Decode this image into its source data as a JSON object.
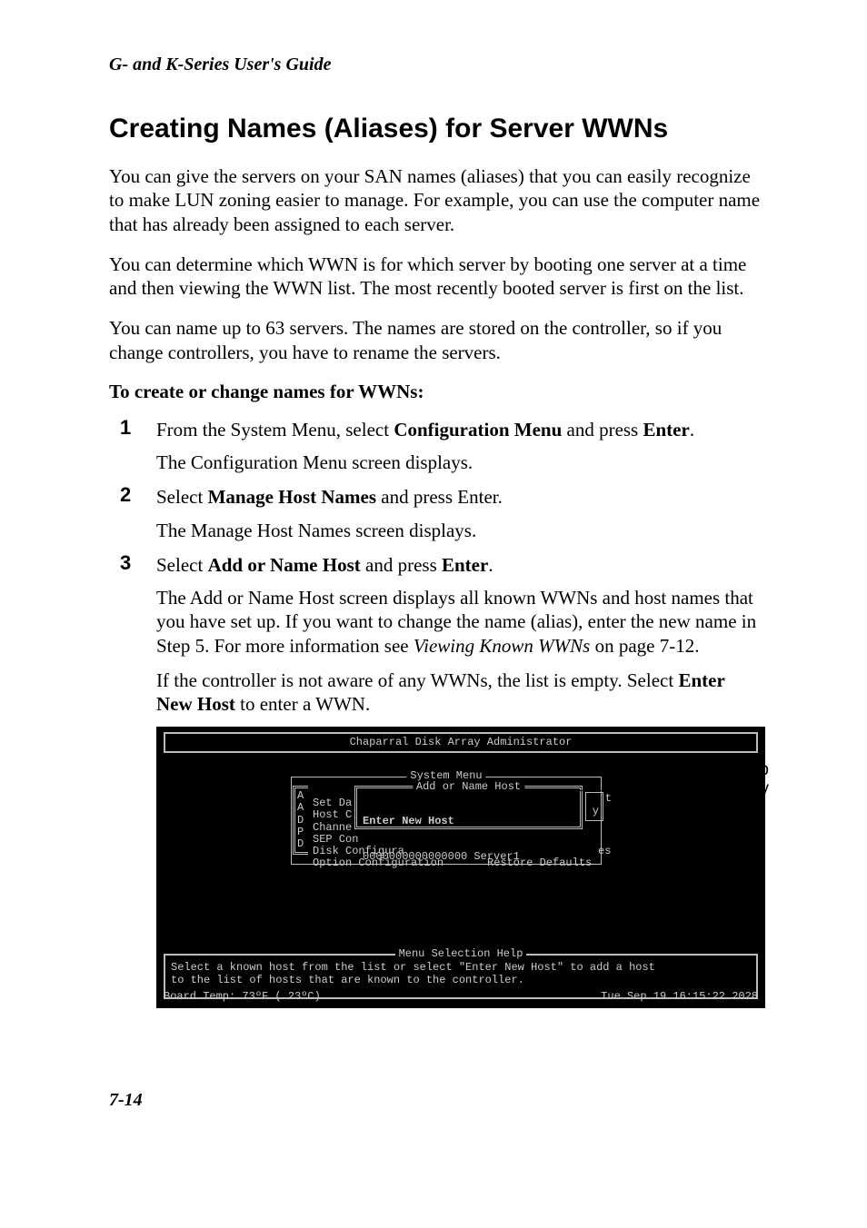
{
  "runningHead": "G- and K-Series User's Guide",
  "sectionTitle": "Creating Names (Aliases) for Server WWNs",
  "para1": "You can give the servers on your SAN names (aliases) that you can easily recognize to make LUN zoning easier to manage. For example, you can use the computer name that has already been assigned to each server.",
  "para2": "You can determine which WWN is for which server by booting one server at a time and then viewing the WWN list. The most recently booted server is first on the list.",
  "para3": "You can name up to 63 servers. The names are stored on the controller, so if you change controllers, you have to rename the servers.",
  "procHead": "To create or change names for WWNs:",
  "steps": [
    {
      "main_a": "From the System Menu, select ",
      "main_b": "Configuration Menu",
      "main_c": " and press ",
      "main_d": "Enter",
      "main_e": ".",
      "sub1": "The Configuration Menu screen displays."
    },
    {
      "main_a": "Select ",
      "main_b": "Manage Host Names",
      "main_c": " and press Enter.",
      "sub1": "The Manage Host Names screen displays."
    },
    {
      "main_a": "Select ",
      "main_b": "Add or Name Host",
      "main_c": " and press ",
      "main_d": "Enter",
      "main_e": ".",
      "sub1_a": "The Add or Name Host screen displays all known WWNs and host names that you have set up. If you want to change the name (alias), enter the new name in Step 5. For more information see ",
      "sub1_b": "Viewing Known WWNs",
      "sub1_c": " on page 7-12.",
      "sub2_a": "If the controller is not aware of any WWNs, the list is empty. Select ",
      "sub2_b": "Enter New Host",
      "sub2_c": " to enter a WWN."
    }
  ],
  "terminal": {
    "title": "Chaparral Disk Array Administrator",
    "sysMenuLabel": "System Menu",
    "addHostLabel": "Add or Name Host",
    "leftCol": "A\nA\nD\nP\nD",
    "midCol": "Set Da\nHost C\nChanne\nSEP Con\nDisk Configura\nOption Configuration",
    "rightMid": "Restore Defaults",
    "enterNew": "Enter New Host",
    "wwnEntry": "0000000000000000 Server1",
    "trailT": "t",
    "trailY": "y",
    "trailEs": "es",
    "helpLabel": "Menu Selection Help",
    "helpText": "Select a known host from the list or select \"Enter New Host\" to add a host\nto the list of hosts that are known to the controller.",
    "statusLeft": "Board Temp:  73ºF ( 23ºC)",
    "statusRight": "Tue Sep 19 16:15:22 2028"
  },
  "callout1": "Name set up",
  "callout2": "previously",
  "pageNum": "7-14"
}
